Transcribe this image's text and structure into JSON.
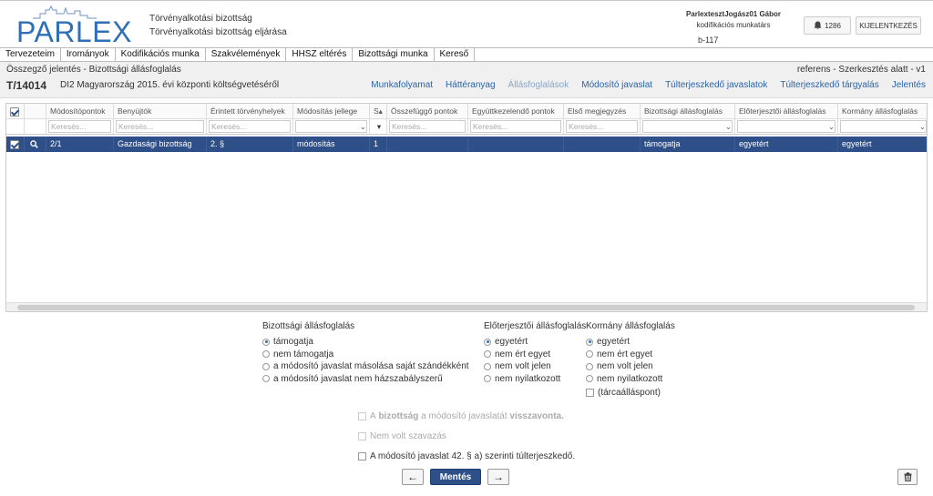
{
  "header": {
    "logo_text": "PARLEX",
    "org_line1": "Törvényalkotási bizottság",
    "org_line2": "Törvényalkotási bizottság eljárása",
    "user_name": "ParlextesztJogász01 Gábor",
    "user_role": "kodifikációs munkatárs",
    "case_code": "b-117",
    "notification_count": "1286",
    "logout_label": "KIJELENTKEZÉS"
  },
  "menu": [
    "Tervezeteim",
    "Irományok",
    "Kodifikációs munka",
    "Szakvélemények",
    "HHSZ eltérés",
    "Bizottsági munka",
    "Kereső"
  ],
  "subheader": {
    "title": "Összegző jelentés - Bizottsági állásfoglalás",
    "status": "referens - Szerkesztés alatt - v1",
    "doc_id": "T/14014",
    "doc_title": "DI2 Magyarország 2015. évi központi költségvetéséről",
    "tabs": [
      {
        "label": "Munkafolyamat",
        "active": true
      },
      {
        "label": "Háttéranyag",
        "active": true
      },
      {
        "label": "Állásfoglalások",
        "active": false
      },
      {
        "label": "Módosító javaslat",
        "active": true
      },
      {
        "label": "Túlterjeszkedő javaslatok",
        "active": true
      },
      {
        "label": "Túlterjeszkedő tárgyalás",
        "active": true
      },
      {
        "label": "Jelentés",
        "active": true
      }
    ]
  },
  "grid": {
    "columns": [
      "",
      "",
      "Módosítópontok",
      "Benyújtók",
      "Érintett törvényhelyek",
      "Módosítás jellege",
      "S",
      "Összefüggő pontok",
      "Együttkezelendő pontok",
      "Első megjegyzés",
      "Bizottsági állásfoglalás",
      "Előterjesztői állásfoglalás",
      "Kormány állásfoglalás"
    ],
    "filter_placeholder": "Keresés...",
    "rows": [
      {
        "selected": true,
        "cells": [
          "2/1",
          "Gazdasági bizottság",
          "2. §",
          "módosítás",
          "1",
          "",
          "",
          "",
          "támogatja",
          "egyetért",
          "egyetért"
        ]
      }
    ]
  },
  "form": {
    "committee": {
      "title": "Bizottsági állásfoglalás",
      "options": [
        {
          "label": "támogatja",
          "selected": true
        },
        {
          "label": "nem támogatja",
          "selected": false
        },
        {
          "label": "a módosító javaslat másolása saját szándékként",
          "selected": false
        },
        {
          "label": "a módosító javaslat nem házszabályszerű",
          "selected": false
        }
      ]
    },
    "submitter": {
      "title": "Előterjesztői állásfoglalás",
      "options": [
        {
          "label": "egyetért",
          "selected": true
        },
        {
          "label": "nem ért egyet",
          "selected": false
        },
        {
          "label": "nem volt jelen",
          "selected": false
        },
        {
          "label": "nem nyilatkozott",
          "selected": false
        }
      ]
    },
    "government": {
      "title": "Kormány állásfoglalás",
      "options": [
        {
          "label": "egyetért",
          "selected": true
        },
        {
          "label": "nem ért egyet",
          "selected": false
        },
        {
          "label": "nem volt jelen",
          "selected": false
        },
        {
          "label": "nem nyilatkozott",
          "selected": false
        }
      ],
      "extra_checkbox": "(tárcaálláspont)"
    },
    "checks": {
      "withdraw_pre": "A",
      "withdraw_b1": "bizottság",
      "withdraw_mid": "a módosító javaslatát",
      "withdraw_b2": "visszavonta.",
      "no_vote": "Nem volt szavazás",
      "overreach": "A módosító javaslat 42. § a) szerinti túlterjeszkedő."
    },
    "save_label": "Mentés",
    "prev_label": "←",
    "next_label": "→"
  }
}
